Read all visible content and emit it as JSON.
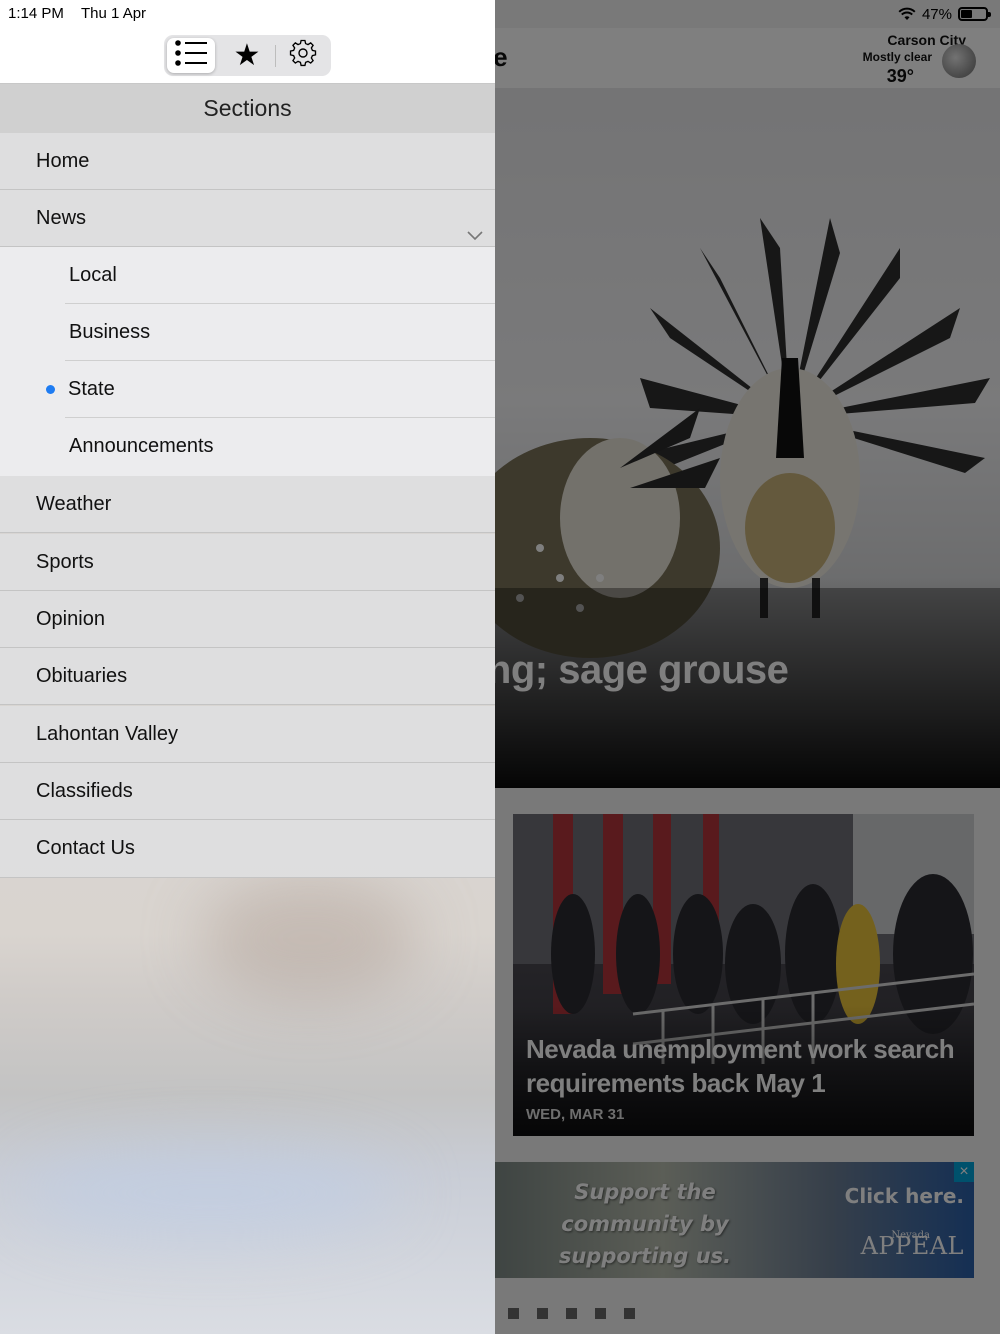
{
  "status_bar": {
    "time": "1:14 PM",
    "date": "Thu 1 Apr",
    "battery": "47%",
    "battery_level": 0.47
  },
  "toolbar": {
    "segments": [
      {
        "name": "sections",
        "icon": "list-icon",
        "selected": true
      },
      {
        "name": "favorites",
        "icon": "star-icon",
        "selected": false
      },
      {
        "name": "settings",
        "icon": "gear-icon",
        "selected": false
      }
    ],
    "star_glyph": "★"
  },
  "menu": {
    "header": "Sections",
    "items": [
      {
        "label": "Home"
      },
      {
        "label": "News",
        "expanded": true,
        "children": [
          {
            "label": "Local"
          },
          {
            "label": "Business"
          },
          {
            "label": "State",
            "selected": true
          },
          {
            "label": "Announcements"
          }
        ]
      },
      {
        "label": "Weather"
      },
      {
        "label": "Sports"
      },
      {
        "label": "Opinion"
      },
      {
        "label": "Obituaries"
      },
      {
        "label": "Lahontan Valley"
      },
      {
        "label": "Classifieds"
      },
      {
        "label": "Contact Us"
      }
    ]
  },
  "background_app": {
    "header_title": "ate",
    "weather": {
      "city": "Carson City",
      "condition": "Mostly clear",
      "temperature": "39°"
    },
    "hero": {
      "title": "razing; sage grouse"
    },
    "card": {
      "title": "Nevada unemployment work search requirements back May 1",
      "date": "WED, MAR 31"
    },
    "ad": {
      "tagline": "Support the community by supporting us.",
      "cta": "Click here.",
      "close": "×",
      "logo_small": "Nevada",
      "logo": "APPEAL"
    },
    "page_dots": 5
  },
  "colors": {
    "accent": "#1e7cf2",
    "dim_overlay": "rgba(0,0,0,0.5)",
    "ad_close": "#00a3d9"
  }
}
